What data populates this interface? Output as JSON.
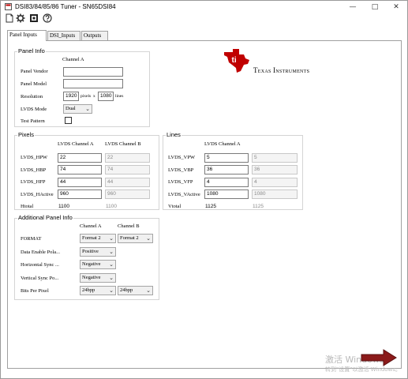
{
  "window": {
    "title": "DSI83/84/85/86 Tuner - SN65DSI84",
    "minimize": "—",
    "maximize": "□",
    "close": "✕"
  },
  "toolbar": {
    "icons": [
      "new-file-icon",
      "gear-icon",
      "chip-icon",
      "help-icon"
    ]
  },
  "tabs": [
    {
      "label": "Panel Inputs",
      "active": true
    },
    {
      "label": "DSI_Inputs",
      "active": false
    },
    {
      "label": "Outputs",
      "active": false
    }
  ],
  "logo": {
    "text_texas": "Texas",
    "text_instruments": "Instruments",
    "color": "#c00000"
  },
  "panel_info": {
    "title": "Panel Info",
    "channel_header": "Channel A",
    "vendor_label": "Panel Vendor",
    "vendor_value": "",
    "model_label": "Panel Model",
    "model_value": "",
    "resolution_label": "Resolution",
    "res_x": "1920",
    "res_pixels_unit": "pixels",
    "res_x_sep": "x",
    "res_y": "1080",
    "res_lines_unit": "lines",
    "lvds_mode_label": "LVDS Mode",
    "lvds_mode_value": "Dual",
    "test_pattern_label": "Test Pattern",
    "test_pattern_checked": false
  },
  "pixels": {
    "title": "Pixels",
    "col_a": "LVDS Channel A",
    "col_b": "LVDS Channel B",
    "rows": [
      {
        "label": "LVDS_HPW",
        "a": "22",
        "b": "22"
      },
      {
        "label": "LVDS_HBP",
        "a": "74",
        "b": "74"
      },
      {
        "label": "LVDS_HFP",
        "a": "44",
        "b": "44"
      },
      {
        "label": "LVDS_HActive",
        "a": "960",
        "b": "960"
      }
    ],
    "total_label": "Htotal",
    "total_a": "1100",
    "total_b": "1100"
  },
  "lines": {
    "title": "Lines",
    "col_a": "LVDS Channel A",
    "rows": [
      {
        "label": "LVDS_VPW",
        "a": "5",
        "b": "5"
      },
      {
        "label": "LVDS_VBP",
        "a": "36",
        "b": "36"
      },
      {
        "label": "LVDS_VFP",
        "a": "4",
        "b": "4"
      },
      {
        "label": "LVDS_VActive",
        "a": "1080",
        "b": "1080"
      }
    ],
    "total_label": "Vtotal",
    "total_a": "1125",
    "total_b": "1125"
  },
  "additional": {
    "title": "Additional Panel Info",
    "col_a": "Channel A",
    "col_b": "Channel B",
    "rows": [
      {
        "label": "FORMAT",
        "a": "Format 2",
        "b": "Format 2"
      },
      {
        "label": "Data Enable Pola...",
        "a": "Positive",
        "b": ""
      },
      {
        "label": "Horizontal Sync ...",
        "a": "Negative",
        "b": ""
      },
      {
        "label": "Vertical Sync Po...",
        "a": "Negative",
        "b": ""
      },
      {
        "label": "Bits Per Pixel",
        "a": "24bpp",
        "b": "24bpp"
      }
    ]
  },
  "watermark": {
    "title": "激活 Windows",
    "subtitle": "转到\"设置\"以激活 Windows。"
  },
  "colors": {
    "ti_red": "#c00000",
    "arrow_red": "#8b1a1a"
  }
}
